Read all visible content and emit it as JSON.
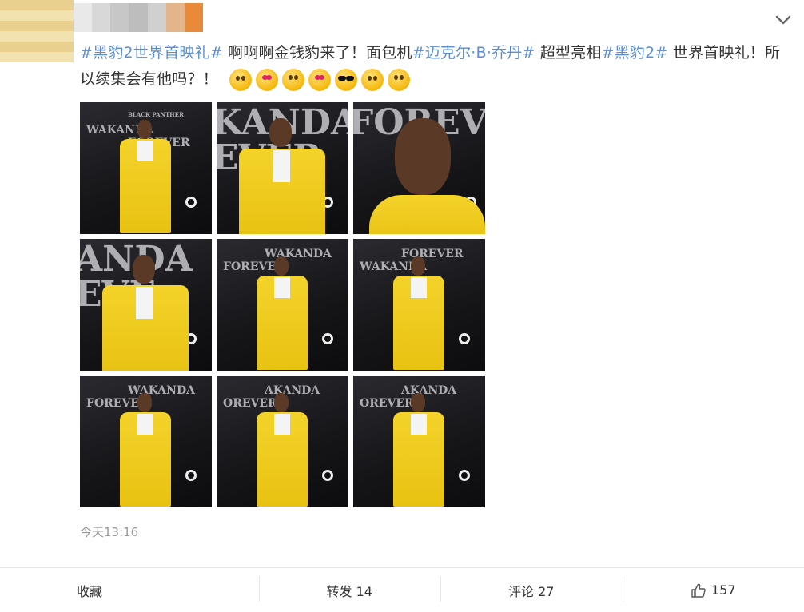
{
  "post": {
    "segments": [
      {
        "type": "tag",
        "text": "#黑豹2世界首映礼#"
      },
      {
        "type": "text",
        "text": " 啊啊啊金钱豹来了！面包机"
      },
      {
        "type": "tag",
        "text": "#迈克尔·B·乔丹#"
      },
      {
        "type": "text",
        "text": " 超型亮相"
      },
      {
        "type": "tag",
        "text": "#黑豹2#"
      },
      {
        "type": "text",
        "text": " 世界首映礼！所以续集会有他吗？！"
      }
    ],
    "emojis": [
      "kiss-emoji",
      "heart-eyes-emoji",
      "scream-emoji",
      "love-emoji",
      "cool-emoji",
      "party-emoji",
      "shock-emoji"
    ],
    "timestamp": "今天13:16"
  },
  "photos": [
    {
      "words": [
        "BLACK PANTHER",
        "WAKANDA",
        "FOREVER"
      ],
      "kind": "full"
    },
    {
      "words": [
        "KANDA",
        "EVER"
      ],
      "kind": "half"
    },
    {
      "words": [
        "FOREVER"
      ],
      "kind": "face"
    },
    {
      "words": [
        "ANDA",
        "EVE"
      ],
      "kind": "half"
    },
    {
      "words": [
        "WAKANDA",
        "FOREVER"
      ],
      "kind": "full"
    },
    {
      "words": [
        "FOREVER",
        "WAKANDA"
      ],
      "kind": "full"
    },
    {
      "words": [
        "WAKANDA",
        "FOREVER"
      ],
      "kind": "full"
    },
    {
      "words": [
        "AKANDA",
        "OREVER"
      ],
      "kind": "full"
    },
    {
      "words": [
        "AKANDA",
        "OREVER"
      ],
      "kind": "full"
    }
  ],
  "actions": {
    "favorite": "收藏",
    "repost": "转发 14",
    "comment": "评论 27",
    "like": "157"
  },
  "colors": {
    "tag": "#5b8ed0",
    "coat": "#f2cf1f",
    "backdrop": "#16161a"
  }
}
